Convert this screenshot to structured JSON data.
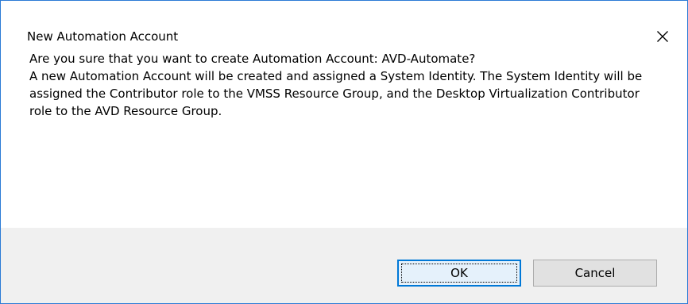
{
  "window": {
    "title": "New Automation Account",
    "close_icon": "close-icon"
  },
  "message": {
    "line1": "Are you sure that you want to create Automation Account: AVD-Automate?",
    "body": "A new Automation Account will be created and assigned a System Identity. The System Identity will be assigned the Contributor role to the VMSS Resource Group, and the Desktop Virtualization Contributor role to the AVD Resource Group."
  },
  "buttons": {
    "ok_label": "OK",
    "cancel_label": "Cancel"
  },
  "colors": {
    "border": "#2b7bd6",
    "footer_bg": "#f0f0f0",
    "default_button_border": "#0078d7",
    "button_bg": "#e1e1e1"
  }
}
